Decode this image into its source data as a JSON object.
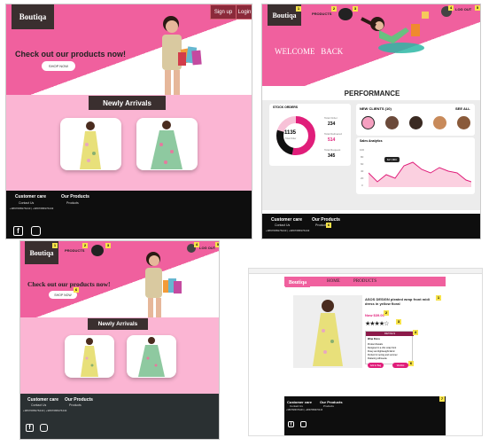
{
  "brand": "Boutiqa",
  "panel1": {
    "buttons": [
      "Sign up",
      "Login"
    ],
    "hero": "Check out our products now!",
    "shop": "SHOP NOW",
    "section": "Newly Arrivals",
    "footer": {
      "care": "Customer care",
      "contact": "Contact Us",
      "phones": "+9897686976443   |   +9897686976443",
      "products": "Our Products",
      "products_link": "Products"
    }
  },
  "panel2": {
    "nav": "PRODUCTS",
    "logout": "LOG OUT",
    "welcome": "WELCOME   BACK",
    "perf": "PERFORMANCE",
    "stock_title": "STOCK ORDERS",
    "stats": [
      {
        "label": "Total Order",
        "value": "234"
      },
      {
        "label": "Total Delivered",
        "value": "514"
      },
      {
        "label": "Total Request",
        "value": "345"
      }
    ],
    "center": "1135",
    "center_sub": "Total Order",
    "clients_title": "NEW CLIENTS (10)",
    "see_all": "SEE ALL",
    "sales_title": "Sales Analytics",
    "tooltip": "$27,860",
    "yaxis": [
      "100",
      "80",
      "60",
      "40",
      "20",
      "0"
    ],
    "footer": {
      "care": "Customer care",
      "contact": "Contact Us",
      "phones": "+9897686976443  |  +9897686976443",
      "products": "Our Products",
      "products_link": "Products"
    }
  },
  "panel3": {
    "nav": "PRODUCTS",
    "logout": "LOG OUT",
    "hero": "Check out our products now!",
    "shop": "SHOP NOW",
    "section": "Newly Arrivals",
    "footer": {
      "care": "Customer care",
      "contact": "Contact Us",
      "phones": "+9897686976443  |  +9897686976443",
      "products": "Our Products",
      "products_link": "Products"
    }
  },
  "panel4": {
    "nav": [
      "HOME",
      "PRODUCTS"
    ],
    "title": "ASOS DESIGN pleated wrap front midi dress in yellow floral",
    "price": "Now $39.00",
    "details": "DETAILS",
    "detail_lines": [
      "Wrap Dress",
      "",
      "Product Details",
      "Designed in a chic wrap front",
      "Flowy and lightweight fabric",
      "Perfect for spring and summer",
      "Flattering silhouette"
    ],
    "buttons": [
      "Add to Bag",
      "Wishlist"
    ],
    "footer": {
      "care": "Customer care",
      "contact": "Contact Us",
      "phones": "+9897686976443  |  +9897686976443",
      "products": "Our Products",
      "products_link": "Products"
    }
  },
  "colors": {
    "pink": "#f0609e",
    "light_pink": "#fbb5d3",
    "dark": "#0e0e0e",
    "logo_bg": "#3a2f2f"
  }
}
